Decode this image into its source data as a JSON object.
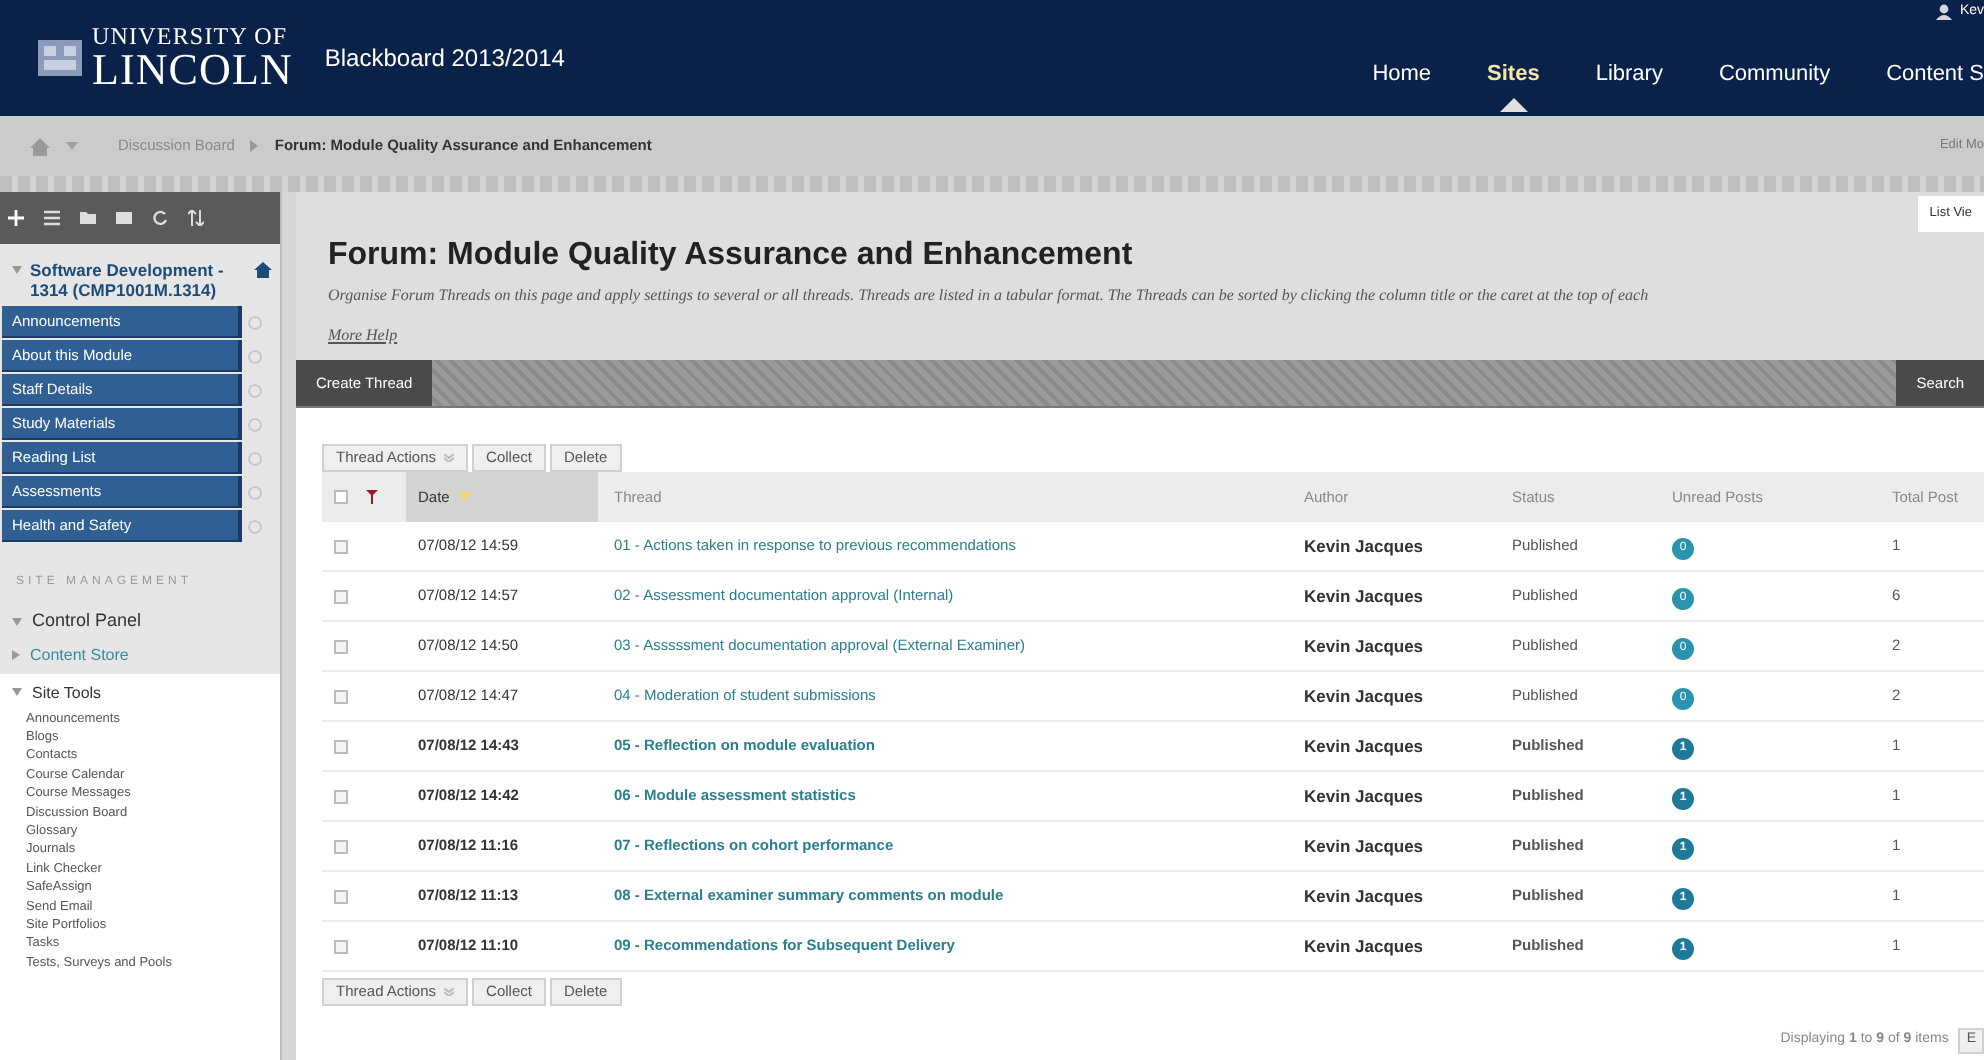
{
  "header": {
    "logo_top": "UNIVERSITY OF",
    "logo_bottom": "LINCOLN",
    "product": "Blackboard 2013/2014",
    "user": "Kev",
    "nav": [
      {
        "label": "Home",
        "selected": false
      },
      {
        "label": "Sites",
        "selected": true
      },
      {
        "label": "Library",
        "selected": false
      },
      {
        "label": "Community",
        "selected": false
      },
      {
        "label": "Content S",
        "selected": false
      }
    ]
  },
  "breadcrumb": {
    "items": [
      "Discussion Board",
      "Forum: Module Quality Assurance and Enhancement"
    ],
    "edit_mode": "Edit Mo"
  },
  "sidebar": {
    "course_title": "Software Development - 1314 (CMP1001M.1314)",
    "menu": [
      "Announcements",
      "About this Module",
      "Staff Details",
      "Study Materials",
      "Reading List",
      "Assessments",
      "Health and Safety"
    ],
    "management_heading": "SITE MANAGEMENT",
    "control_panel": "Control Panel",
    "content_store": "Content Store",
    "site_tools": {
      "label": "Site Tools",
      "expanded": true,
      "children": [
        "Announcements",
        "Blogs",
        "Contacts",
        "Course Calendar",
        "Course Messages",
        "Discussion Board",
        "Glossary",
        "Journals",
        "Link Checker",
        "SafeAssign",
        "Send Email",
        "Site Portfolios",
        "Tasks",
        "Tests, Surveys and Pools"
      ]
    }
  },
  "page": {
    "list_view": "List Vie",
    "title": "Forum: Module Quality Assurance and Enhancement",
    "description": "Organise Forum Threads on this page and apply settings to several or all threads. Threads are listed in a tabular format. The Threads can be sorted by clicking the column title or the caret at the top of each",
    "more_help": "More Help"
  },
  "action_bar": {
    "create": "Create Thread",
    "search": "Search"
  },
  "table_actions": [
    "Thread Actions",
    "Collect",
    "Delete"
  ],
  "select_all_checked": false,
  "columns": [
    "Date",
    "Thread",
    "Author",
    "Status",
    "Unread Posts",
    "Total Post"
  ],
  "rows": [
    {
      "date": "07/08/12 14:59",
      "thread": "01 - Actions taken in response to previous recommendations",
      "author": "Kevin Jacques",
      "status": "Published",
      "unread": "0",
      "total": "1",
      "checked": false
    },
    {
      "date": "07/08/12 14:57",
      "thread": "02 - Assessment documentation approval (Internal)",
      "author": "Kevin Jacques",
      "status": "Published",
      "unread": "0",
      "total": "6",
      "checked": false
    },
    {
      "date": "07/08/12 14:50",
      "thread": "03 - Asssssment documentation approval (External Examiner)",
      "author": "Kevin Jacques",
      "status": "Published",
      "unread": "0",
      "total": "2",
      "checked": false
    },
    {
      "date": "07/08/12 14:47",
      "thread": "04 - Moderation of student submissions",
      "author": "Kevin Jacques",
      "status": "Published",
      "unread": "0",
      "total": "2",
      "checked": false
    },
    {
      "date": "07/08/12 14:43",
      "thread": "05 - Reflection on module evaluation",
      "author": "Kevin Jacques",
      "status": "Published",
      "unread": "1",
      "total": "1",
      "checked": false
    },
    {
      "date": "07/08/12 14:42",
      "thread": "06 - Module assessment statistics",
      "author": "Kevin Jacques",
      "status": "Published",
      "unread": "1",
      "total": "1",
      "checked": false
    },
    {
      "date": "07/08/12 11:16",
      "thread": "07 - Reflections on cohort performance",
      "author": "Kevin Jacques",
      "status": "Published",
      "unread": "1",
      "total": "1",
      "checked": false
    },
    {
      "date": "07/08/12 11:13",
      "thread": "08 - External examiner summary comments on module",
      "author": "Kevin Jacques",
      "status": "Published",
      "unread": "1",
      "total": "1",
      "checked": false
    },
    {
      "date": "07/08/12 11:10",
      "thread": "09 - Recommendations for Subsequent Delivery",
      "author": "Kevin Jacques",
      "status": "Published",
      "unread": "1",
      "total": "1",
      "checked": false
    }
  ],
  "bottom_actions": [
    "Thread Actions",
    "Collect",
    "Delete"
  ],
  "footer": {
    "displaying": "Displaying **1** to **9** of **9** items",
    "edit": "E"
  }
}
